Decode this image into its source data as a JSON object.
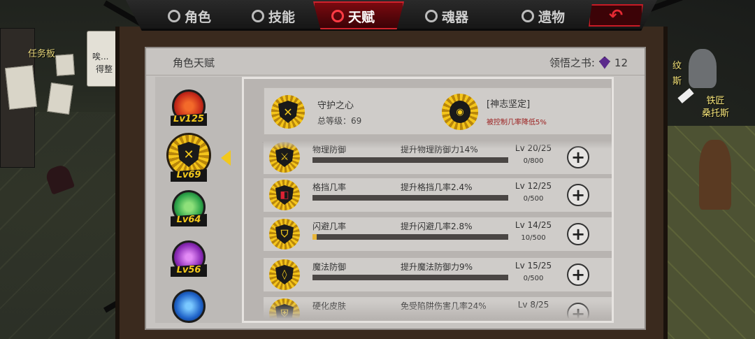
{
  "tabs": [
    {
      "label": "角色"
    },
    {
      "label": "技能"
    },
    {
      "label": "天赋"
    },
    {
      "label": "魂器"
    },
    {
      "label": "遗物"
    }
  ],
  "back_icon": "back-arrow-icon",
  "scene": {
    "board_label": "任务板",
    "npc_name_line1": "铁匠",
    "npc_name_line2": "桑托斯",
    "partial_dialog_1": "唉...",
    "partial_dialog_2": "得整",
    "partial_right": "纹",
    "partial_right2": "斯"
  },
  "panel": {
    "title": "角色天赋",
    "book_label": "领悟之书:",
    "book_count": "12"
  },
  "heroes": [
    {
      "lv": "Lv125",
      "color": "#c62a1a",
      "selected": false
    },
    {
      "lv": "Lv69",
      "color": "#d8a520",
      "selected": true
    },
    {
      "lv": "Lv64",
      "color": "#2ea44a",
      "selected": false
    },
    {
      "lv": "Lv56",
      "color": "#8a2ab6",
      "selected": false
    },
    {
      "lv": "",
      "color": "#1e62c8",
      "selected": false
    }
  ],
  "summary": {
    "name": "守护之心",
    "level": "总等级：69",
    "bonus_name": "[神志坚定]",
    "bonus_desc": "被控制几率降低5%"
  },
  "talents": [
    {
      "name": "物理防御",
      "desc": "提升物理防御力14%",
      "lv": "Lv 20/25",
      "prog": "0/800",
      "fill": 0.0
    },
    {
      "name": "格挡几率",
      "desc": "提升格挡几率2.4%",
      "lv": "Lv 12/25",
      "prog": "0/500",
      "fill": 0.0
    },
    {
      "name": "闪避几率",
      "desc": "提升闪避几率2.8%",
      "lv": "Lv 14/25",
      "prog": "10/500",
      "fill": 0.02
    },
    {
      "name": "魔法防御",
      "desc": "提升魔法防御力9%",
      "lv": "Lv 15/25",
      "prog": "0/500",
      "fill": 0.0
    },
    {
      "name": "硬化皮肤",
      "desc": "免受陷阱伤害几率24%",
      "lv": "Lv 8/25",
      "prog": "",
      "fill": 0.0
    }
  ]
}
